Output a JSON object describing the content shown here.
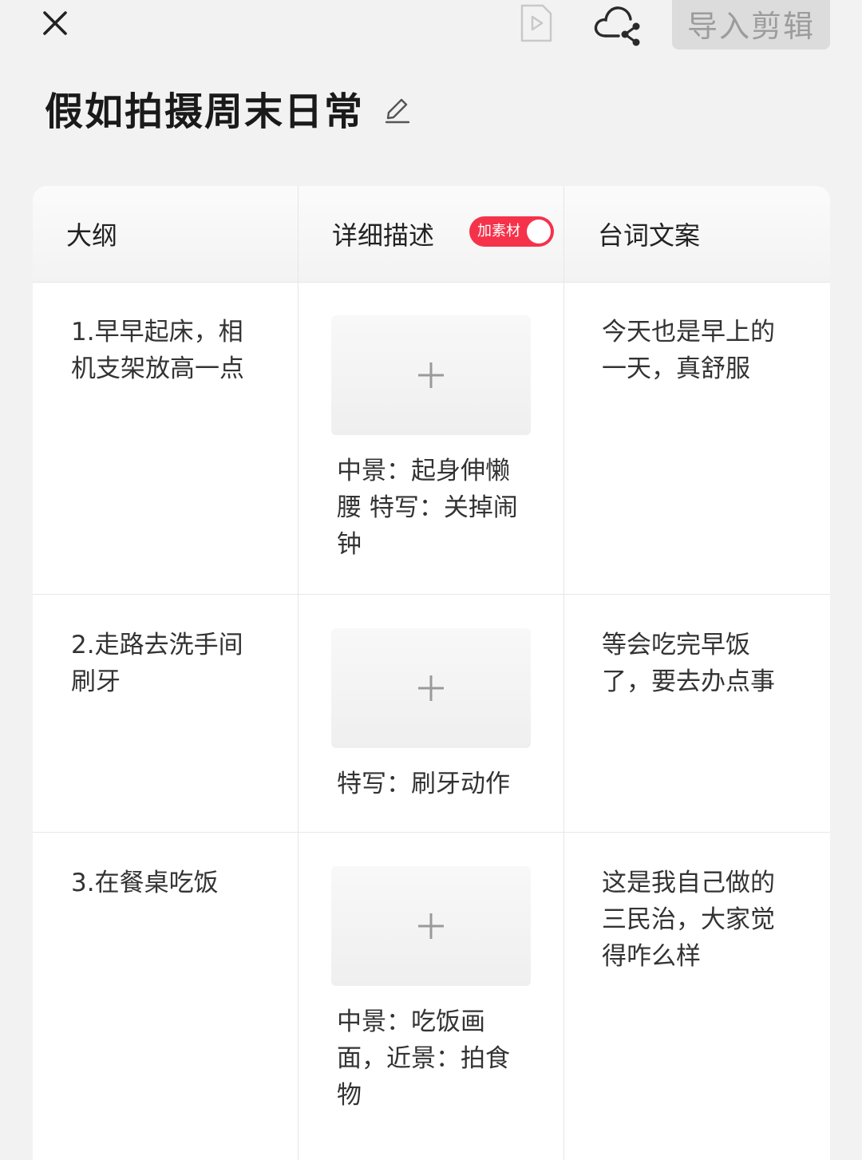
{
  "topbar": {
    "import_label": "导入剪辑"
  },
  "page": {
    "title": "假如拍摄周末日常"
  },
  "table": {
    "headers": {
      "outline": "大纲",
      "detail": "详细描述",
      "script": "台词文案"
    },
    "toggle_label": "加素材",
    "toggle_on": true,
    "rows": [
      {
        "outline": "1.早早起床，相机支架放高一点",
        "detail": "中景：起身伸懒腰 特写：关掉闹钟",
        "script": "今天也是早上的一天，真舒服"
      },
      {
        "outline": "2.走路去洗手间刷牙",
        "detail": "特写：刷牙动作",
        "script": "等会吃完早饭了，要去办点事"
      },
      {
        "outline": "3.在餐桌吃饭",
        "detail": "中景：吃饭画面，近景：拍食物",
        "script": "这是我自己做的三民治，大家觉得咋么样"
      }
    ]
  },
  "icons": {
    "close": "close-icon",
    "preview": "play-file-icon",
    "cloud_share": "cloud-share-icon",
    "edit": "pencil-icon",
    "add": "plus-icon"
  },
  "colors": {
    "toggle_on": "#f5324a",
    "import_button_bg": "#dcdcdc",
    "import_button_text": "#9c9c9c"
  }
}
